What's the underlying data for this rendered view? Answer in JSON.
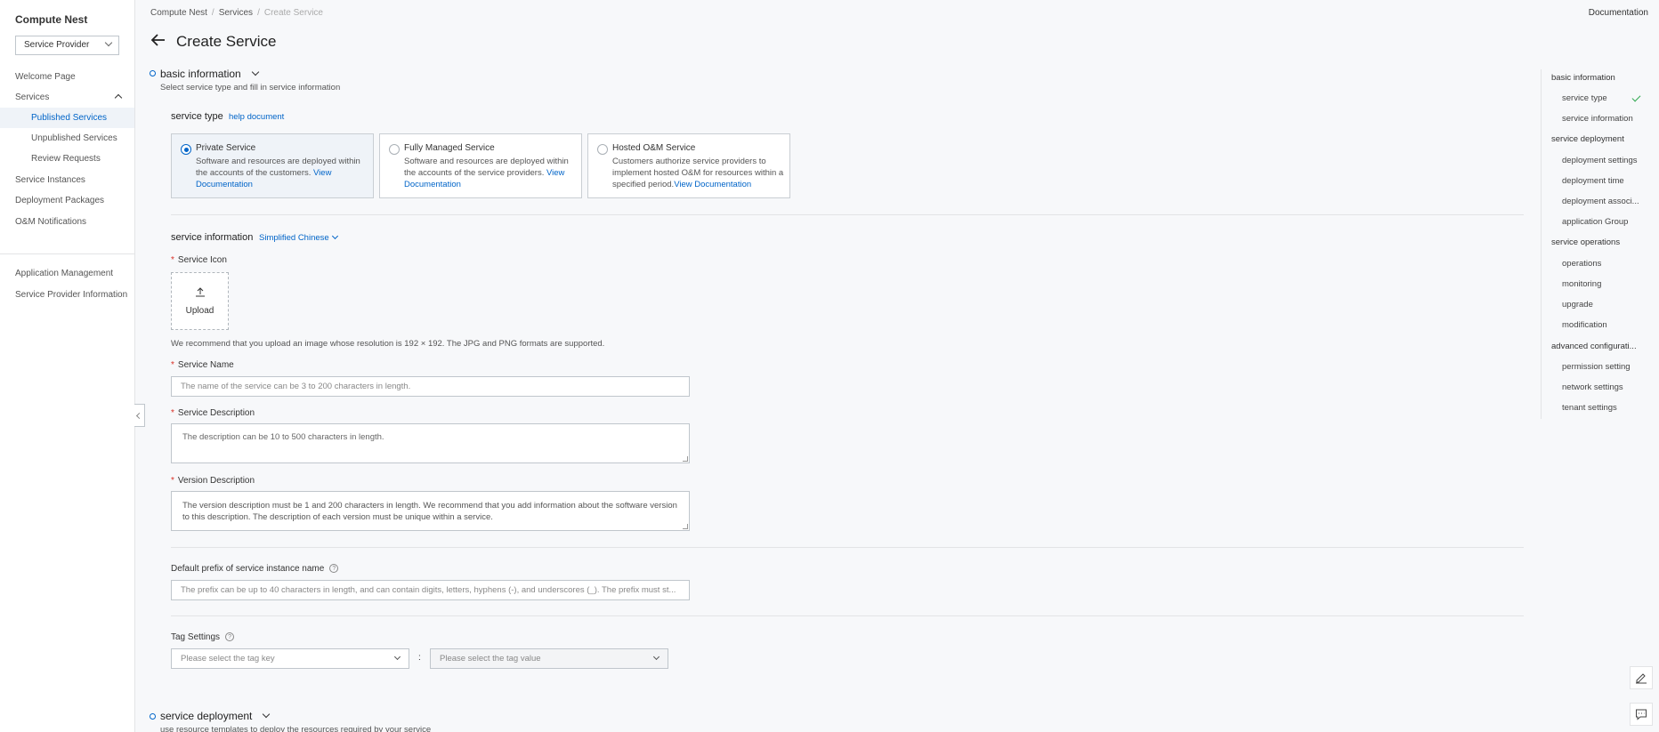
{
  "sidebar": {
    "title": "Compute Nest",
    "role_select": "Service Provider",
    "items": [
      {
        "label": "Welcome Page"
      },
      {
        "label": "Services"
      },
      {
        "label": "Published Services"
      },
      {
        "label": "Unpublished Services"
      },
      {
        "label": "Review Requests"
      },
      {
        "label": "Service Instances"
      },
      {
        "label": "Deployment Packages"
      },
      {
        "label": "O&M Notifications"
      },
      {
        "label": "Application Management"
      },
      {
        "label": "Service Provider Information"
      }
    ]
  },
  "breadcrumb": [
    "Compute Nest",
    "Services",
    "Create Service"
  ],
  "header": {
    "documentation": "Documentation",
    "title": "Create Service"
  },
  "basic": {
    "title": "basic information",
    "desc": "Select service type and fill in service information",
    "service_type_label": "service type",
    "help_document": "help document",
    "cards": [
      {
        "title": "Private Service",
        "desc": "Software and resources are deployed within the accounts of the customers.",
        "link": "View Documentation",
        "selected": true
      },
      {
        "title": "Fully Managed Service",
        "desc": "Software and resources are deployed within the accounts of the service providers.",
        "link": "View Documentation",
        "selected": false
      },
      {
        "title": "Hosted O&M Service",
        "desc": "Customers authorize service providers to implement hosted O&M for resources within a specified period.",
        "link": "View Documentation",
        "selected": false
      }
    ],
    "service_info_label": "service information",
    "language": "Simplified Chinese",
    "icon_label": "Service Icon",
    "upload": "Upload",
    "icon_hint": "We recommend that you upload an image whose resolution is 192 × 192. The JPG and PNG formats are supported.",
    "name_label": "Service Name",
    "name_placeholder": "The name of the service can be 3 to 200 characters in length.",
    "desc_label": "Service Description",
    "desc_placeholder": "The description can be 10 to 500 characters in length.",
    "version_label": "Version Description",
    "version_placeholder": "The version description must be 1 and 200 characters in length. We recommend that you add information about the software version to this description. The description of each version must be unique within a service.",
    "prefix_label": "Default prefix of service instance name",
    "prefix_placeholder": "The prefix can be up to 40 characters in length, and can contain digits, letters, hyphens (-), and underscores (_). The prefix must st...",
    "tag_label": "Tag Settings",
    "tag_key_placeholder": "Please select the tag key",
    "tag_value_placeholder": "Please select the tag value",
    "colon": ":"
  },
  "deployment": {
    "title": "service deployment",
    "desc": "use resource templates to deploy the resources required by your service"
  },
  "right_nav": {
    "groups": [
      {
        "label": "basic information",
        "items": [
          "service type",
          "service information"
        ]
      },
      {
        "label": "service deployment",
        "items": [
          "deployment settings",
          "deployment time",
          "deployment associ...",
          "application Group"
        ]
      },
      {
        "label": "service operations",
        "items": [
          "operations",
          "monitoring",
          "upgrade",
          "modification"
        ]
      },
      {
        "label": "advanced configurati...",
        "items": [
          "permission setting",
          "network settings",
          "tenant settings"
        ]
      }
    ]
  },
  "icons": [
    "back-arrow-icon",
    "chevron-down-icon",
    "upload-icon",
    "question-icon",
    "check-icon",
    "edit-icon",
    "feedback-icon"
  ],
  "colors": {
    "accent": "#0064c8",
    "selected_bg": "#eff3f8",
    "required": "#d93026",
    "success": "#2fa84f"
  }
}
